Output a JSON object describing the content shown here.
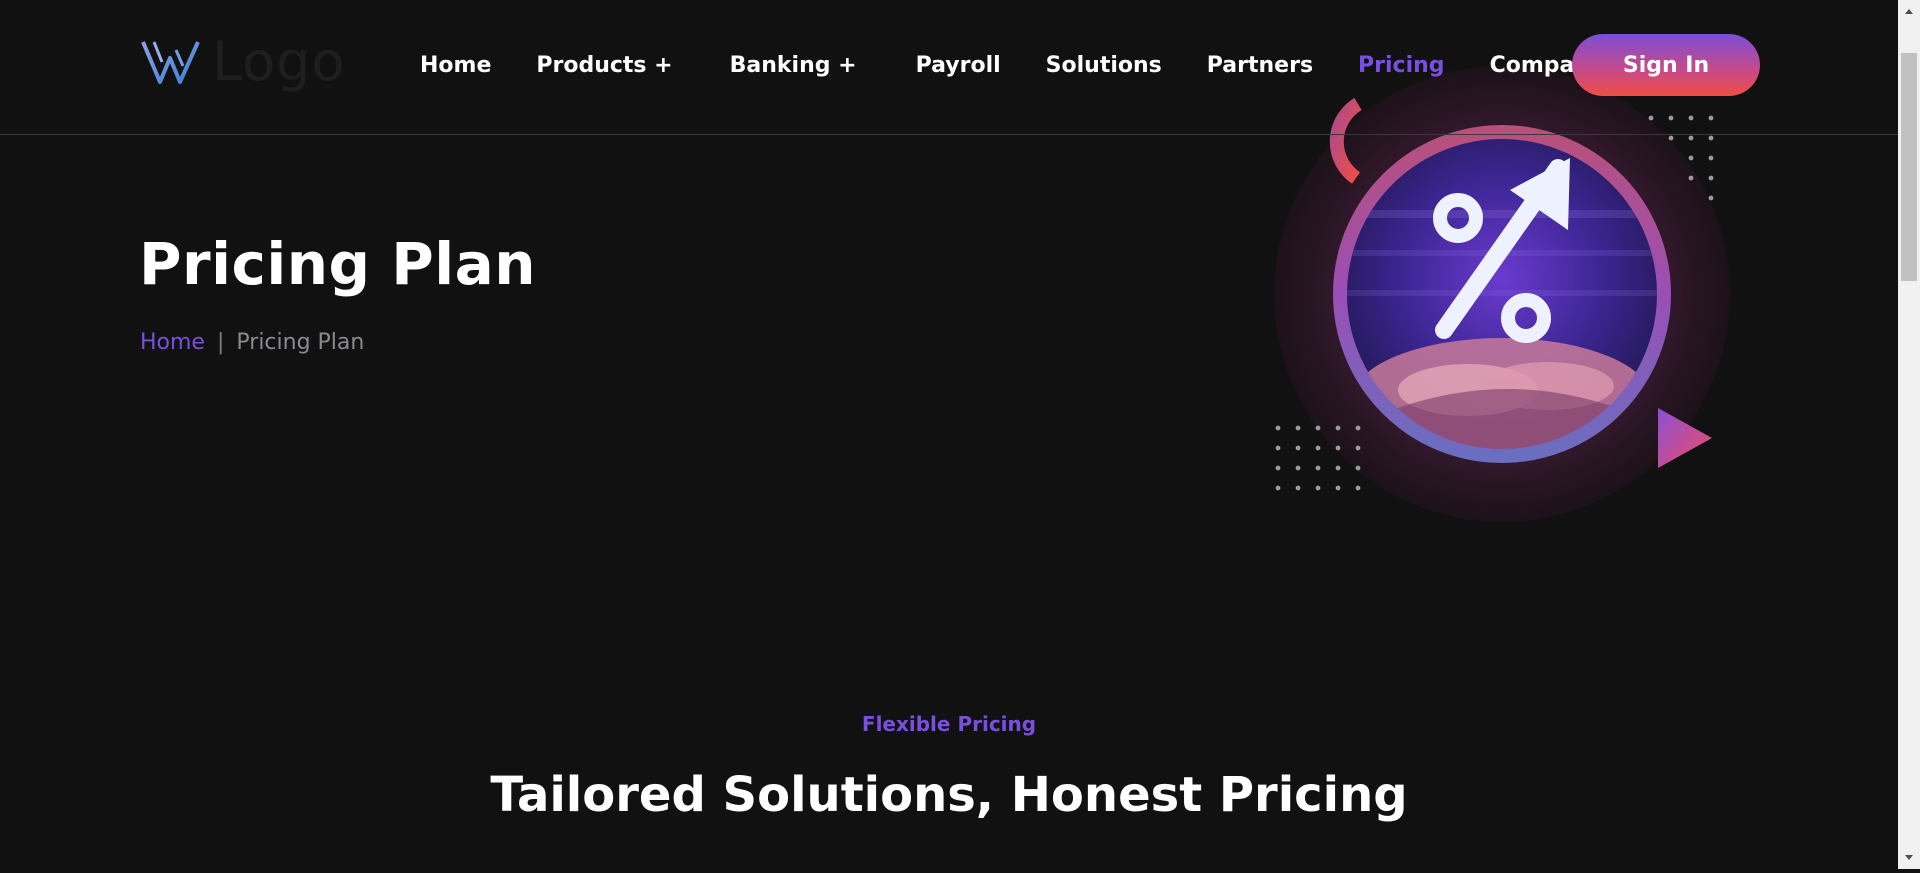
{
  "header": {
    "logo_text": "Logo",
    "nav": [
      {
        "label": "Home"
      },
      {
        "label": "Products +"
      },
      {
        "label": "Banking +"
      },
      {
        "label": "Payroll"
      },
      {
        "label": "Solutions"
      },
      {
        "label": "Partners"
      },
      {
        "label": "Pricing",
        "active": true
      },
      {
        "label": "Company +"
      }
    ],
    "sign_in": "Sign In"
  },
  "hero": {
    "title": "Pricing Plan",
    "breadcrumb": {
      "home": "Home",
      "separator": "|",
      "current": "Pricing Plan"
    },
    "illustration": "percentage-growth-icon"
  },
  "section": {
    "tag": "Flexible Pricing",
    "title": "Tailored Solutions, Honest Pricing"
  },
  "colors": {
    "background": "#111112",
    "accent": "#7a4fe0",
    "button_gradient_start": "#7b4fd6",
    "button_gradient_end": "#ef4e43"
  }
}
